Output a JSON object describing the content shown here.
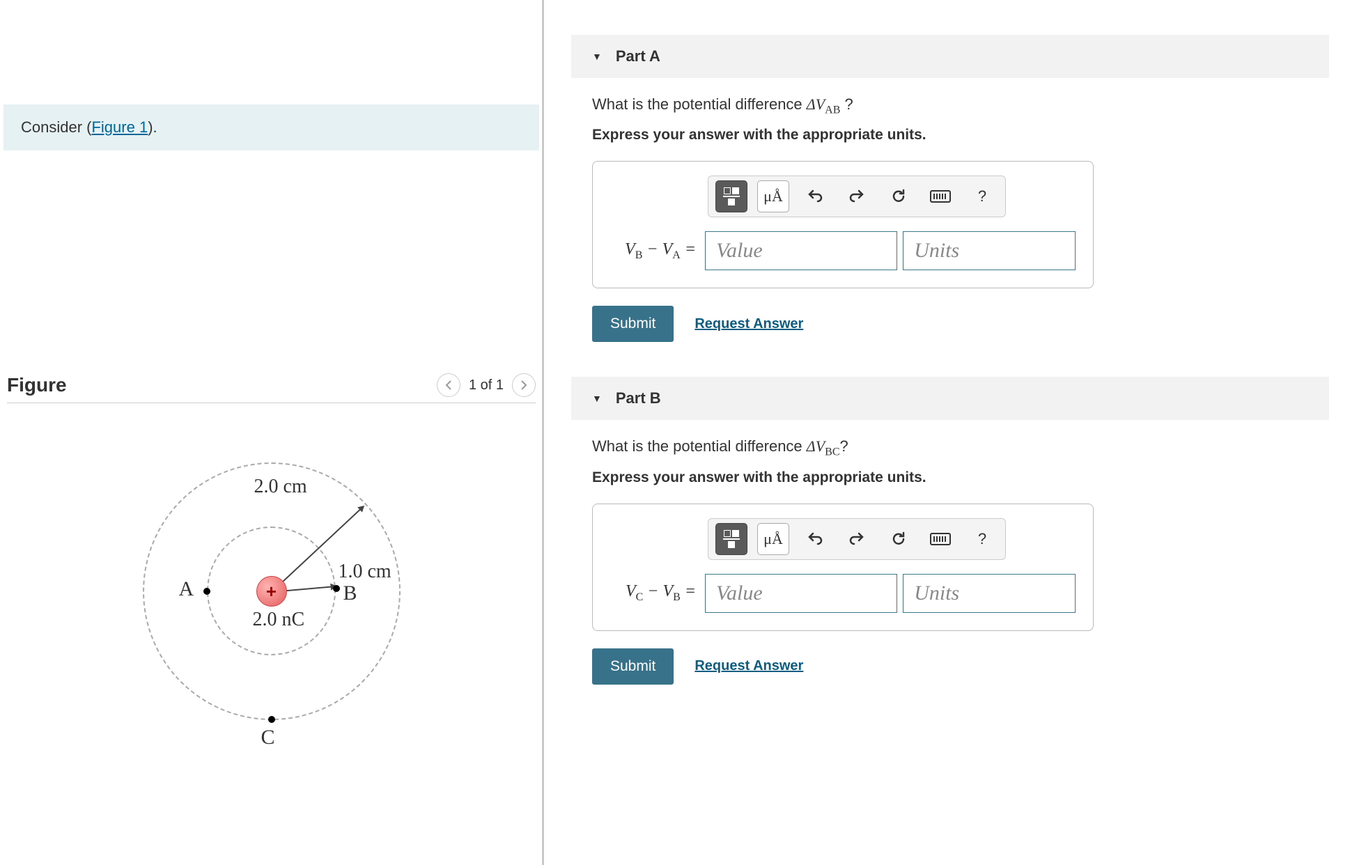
{
  "left": {
    "prompt_prefix": "Consider (",
    "figure_link": "Figure 1",
    "prompt_suffix": ").",
    "figure_heading": "Figure",
    "page_indicator": "1 of 1",
    "figure": {
      "label_A": "A",
      "label_B": "B",
      "label_C": "C",
      "radius_outer": "2.0 cm",
      "radius_inner": "1.0 cm",
      "charge": "2.0 nC",
      "plus": "+"
    }
  },
  "partA": {
    "title": "Part A",
    "question_prefix": "What is the potential difference ",
    "question_delta": "ΔV",
    "question_sub": "AB",
    "question_suffix": " ?",
    "instruction": "Express your answer with the appropriate units.",
    "lhs_v1": "V",
    "lhs_s1": "B",
    "lhs_minus": " − ",
    "lhs_v2": "V",
    "lhs_s2": "A",
    "lhs_eq": " =",
    "value_placeholder": "Value",
    "units_placeholder": "Units",
    "submit": "Submit",
    "request": "Request Answer",
    "units_btn": "μÅ",
    "help": "?"
  },
  "partB": {
    "title": "Part B",
    "question_prefix": "What is the potential difference ",
    "question_delta": "ΔV",
    "question_sub": "BC",
    "question_suffix": "?",
    "instruction": "Express your answer with the appropriate units.",
    "lhs_v1": "V",
    "lhs_s1": "C",
    "lhs_minus": " − ",
    "lhs_v2": "V",
    "lhs_s2": "B",
    "lhs_eq": " =",
    "value_placeholder": "Value",
    "units_placeholder": "Units",
    "submit": "Submit",
    "request": "Request Answer",
    "units_btn": "μÅ",
    "help": "?"
  }
}
